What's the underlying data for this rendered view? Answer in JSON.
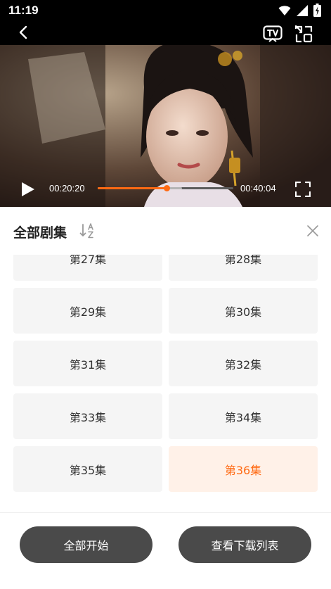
{
  "status_bar": {
    "time": "11:19",
    "icons": [
      "wifi-icon",
      "signal-icon",
      "battery-charging-icon"
    ]
  },
  "top_bar": {
    "icons": [
      "back-icon",
      "tv-cast-icon",
      "switch-icon"
    ]
  },
  "player": {
    "current_time": "00:20:20",
    "duration": "00:40:04",
    "progress_fraction": 0.508,
    "buffered_fraction": 0.62,
    "accent_color": "#ff6a13"
  },
  "panel": {
    "title": "全部剧集",
    "sort_icon": "sort-az-icon",
    "close_icon": "close-icon",
    "episodes": [
      {
        "label": "第27集",
        "active": false
      },
      {
        "label": "第28集",
        "active": false
      },
      {
        "label": "第29集",
        "active": false
      },
      {
        "label": "第30集",
        "active": false
      },
      {
        "label": "第31集",
        "active": false
      },
      {
        "label": "第32集",
        "active": false
      },
      {
        "label": "第33集",
        "active": false
      },
      {
        "label": "第34集",
        "active": false
      },
      {
        "label": "第35集",
        "active": false
      },
      {
        "label": "第36集",
        "active": true
      }
    ]
  },
  "footer": {
    "start_all_label": "全部开始",
    "view_downloads_label": "查看下载列表"
  }
}
